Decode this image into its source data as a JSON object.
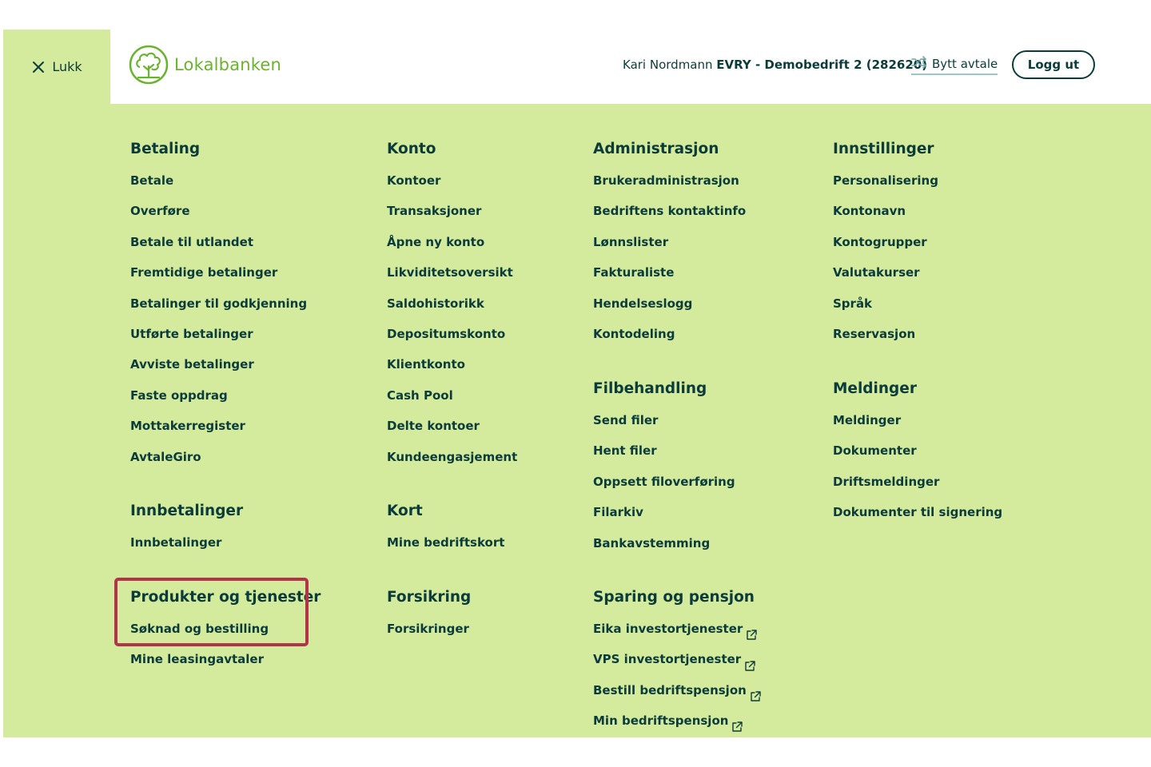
{
  "header": {
    "close_label": "Lukk",
    "logo_text": "Lokalbanken",
    "user_name": "Kari Nordmann",
    "company": "EVRY - Demobedrift 2 (282620)",
    "switch_label": "Bytt avtale",
    "logout_label": "Logg ut"
  },
  "colors": {
    "panel": "#d4eb9d",
    "text": "#0b3b3b",
    "brand_green": "#6ab42d",
    "highlight": "#b3334a"
  },
  "col1": {
    "betaling": {
      "title": "Betaling",
      "items": [
        "Betale",
        "Overføre",
        "Betale til utlandet",
        "Fremtidige betalinger",
        "Betalinger til godkjenning",
        "Utførte betalinger",
        "Avviste betalinger",
        "Faste oppdrag",
        "Mottakerregister",
        "AvtaleGiro"
      ]
    },
    "innbetalinger": {
      "title": "Innbetalinger",
      "items": [
        "Innbetalinger"
      ]
    },
    "produkter": {
      "title": "Produkter og tjenester",
      "items": [
        "Søknad og bestilling",
        "Mine leasingavtaler"
      ]
    }
  },
  "col2": {
    "konto": {
      "title": "Konto",
      "items": [
        "Kontoer",
        "Transaksjoner",
        "Åpne ny konto",
        "Likviditetsoversikt",
        "Saldohistorikk",
        "Depositumskonto",
        "Klientkonto",
        "Cash Pool",
        "Delte kontoer",
        "Kundeengasjement"
      ]
    },
    "kort": {
      "title": "Kort",
      "items": [
        "Mine bedriftskort"
      ]
    },
    "forsikring": {
      "title": "Forsikring",
      "items": [
        "Forsikringer"
      ]
    }
  },
  "col3": {
    "administrasjon": {
      "title": "Administrasjon",
      "items": [
        "Brukeradministrasjon",
        "Bedriftens kontaktinfo",
        "Lønnslister",
        "Fakturaliste",
        "Hendelseslogg",
        "Kontodeling"
      ]
    },
    "filbehandling": {
      "title": "Filbehandling",
      "items": [
        "Send filer",
        "Hent filer",
        "Oppsett filoverføring",
        "Filarkiv",
        "Bankavstemming"
      ]
    },
    "sparing": {
      "title": "Sparing og pensjon",
      "items": [
        "Eika investortjenester",
        "VPS investortjenester",
        "Bestill bedriftspensjon",
        "Min bedriftspensjon"
      ]
    }
  },
  "col4": {
    "innstillinger": {
      "title": "Innstillinger",
      "items": [
        "Personalisering",
        "Kontonavn",
        "Kontogrupper",
        "Valutakurser",
        "Språk",
        "Reservasjon"
      ]
    },
    "meldinger": {
      "title": "Meldinger",
      "items": [
        "Meldinger",
        "Dokumenter",
        "Driftsmeldinger",
        "Dokumenter til signering"
      ]
    }
  }
}
